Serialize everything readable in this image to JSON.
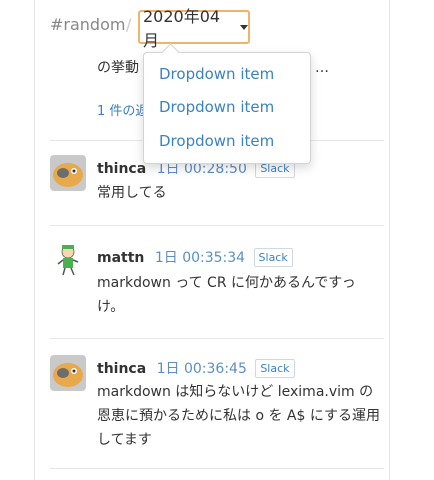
{
  "breadcrumb": {
    "channel": "#random",
    "separator": "/"
  },
  "month_selector": {
    "value": "2020年04月"
  },
  "dropdown": {
    "items": [
      "Dropdown item",
      "Dropdown item",
      "Dropdown item"
    ]
  },
  "partial": {
    "text": "の挙動",
    "ellipsis": "…",
    "link": "1 件の返"
  },
  "messages": [
    {
      "user": "thinca",
      "time": "1日 00:28:50",
      "source": "Slack",
      "text": "常用してる",
      "avatar": "thinca-avatar"
    },
    {
      "user": "mattn",
      "time": "1日 00:35:34",
      "source": "Slack",
      "text": "markdown って CR に何かあるんですっけ。",
      "avatar": "mattn-avatar"
    },
    {
      "user": "thinca",
      "time": "1日 00:36:45",
      "source": "Slack",
      "text": "markdown は知らないけど lexima.vim の恩恵に預かるために私は o を A$ にする運用してます",
      "avatar": "thinca-avatar"
    }
  ],
  "colors": {
    "link": "#3b82c4",
    "time": "#5c8fc6",
    "focus_border": "#f0b36a"
  }
}
